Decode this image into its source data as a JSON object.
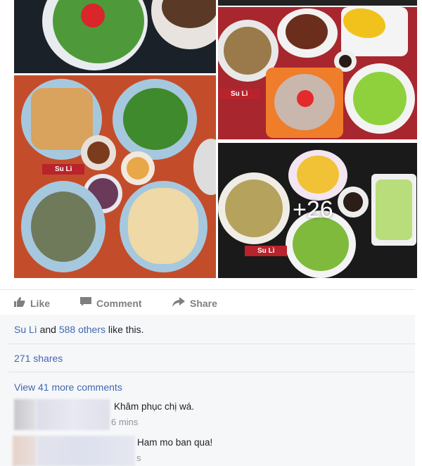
{
  "photos": {
    "watermark": "Su Lì",
    "more_count": "+26"
  },
  "actions": {
    "like": "Like",
    "comment": "Comment",
    "share": "Share"
  },
  "likes": {
    "name": "Su Lì",
    "and": " and ",
    "others": "588 others",
    "suffix": " like this."
  },
  "shares": "271 shares",
  "view_more": "View 41 more comments",
  "comments": [
    {
      "text": "Khâm phục chị wá.",
      "time": "6 mins"
    },
    {
      "text": "Ham mo ban qua!",
      "time": "s"
    }
  ]
}
